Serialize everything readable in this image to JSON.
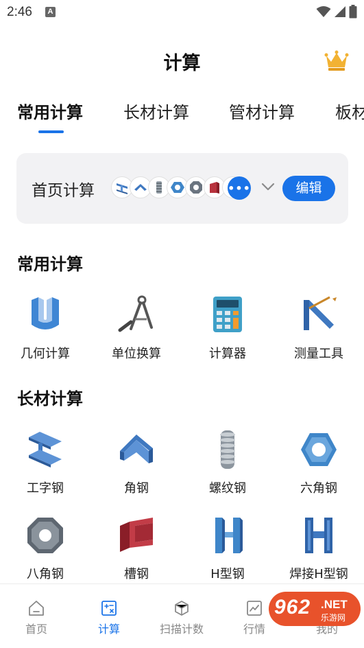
{
  "status_bar": {
    "time": "2:46",
    "notification_letter": "A"
  },
  "header": {
    "title": "计算",
    "vip_icon": "crown-icon"
  },
  "tabs": [
    {
      "label": "常用计算",
      "active": true
    },
    {
      "label": "长材计算",
      "active": false
    },
    {
      "label": "管材计算",
      "active": false
    },
    {
      "label": "板材",
      "active": false
    }
  ],
  "home_card": {
    "label": "首页计算",
    "more_label": "•••",
    "edit_label": "编辑",
    "mini_icons": [
      "i-beam-icon",
      "angle-steel-icon",
      "rebar-icon",
      "hex-nut-icon",
      "octagon-nut-icon",
      "channel-steel-icon"
    ]
  },
  "sections": {
    "common": {
      "title": "常用计算",
      "items": [
        {
          "label": "几何计算",
          "icon": "geometry-icon"
        },
        {
          "label": "单位换算",
          "icon": "compass-icon"
        },
        {
          "label": "计算器",
          "icon": "calculator-icon"
        },
        {
          "label": "测量工具",
          "icon": "ruler-icon"
        }
      ]
    },
    "long": {
      "title": "长材计算",
      "items": [
        {
          "label": "工字钢",
          "icon": "i-beam-icon"
        },
        {
          "label": "角钢",
          "icon": "angle-steel-icon"
        },
        {
          "label": "螺纹钢",
          "icon": "rebar-icon"
        },
        {
          "label": "六角钢",
          "icon": "hex-steel-icon"
        },
        {
          "label": "八角钢",
          "icon": "octagon-steel-icon"
        },
        {
          "label": "槽钢",
          "icon": "channel-steel-icon"
        },
        {
          "label": "H型钢",
          "icon": "h-beam-icon"
        },
        {
          "label": "焊接H型钢",
          "icon": "welded-h-beam-icon"
        }
      ]
    }
  },
  "bottom_nav": [
    {
      "label": "首页",
      "icon": "home-icon",
      "active": false
    },
    {
      "label": "计算",
      "icon": "calculate-icon",
      "active": true
    },
    {
      "label": "扫描计数",
      "icon": "scan-icon",
      "active": false
    },
    {
      "label": "行情",
      "icon": "chart-icon",
      "active": false
    },
    {
      "label": "我的",
      "icon": "profile-icon",
      "active": false
    }
  ],
  "watermark": {
    "big": "962",
    "net": ".NET",
    "sub": "乐游网"
  },
  "colors": {
    "accent": "#1a73e8",
    "card_bg": "#f2f2f4",
    "steel_blue": "#3f78c0",
    "channel_red": "#b8323d"
  }
}
